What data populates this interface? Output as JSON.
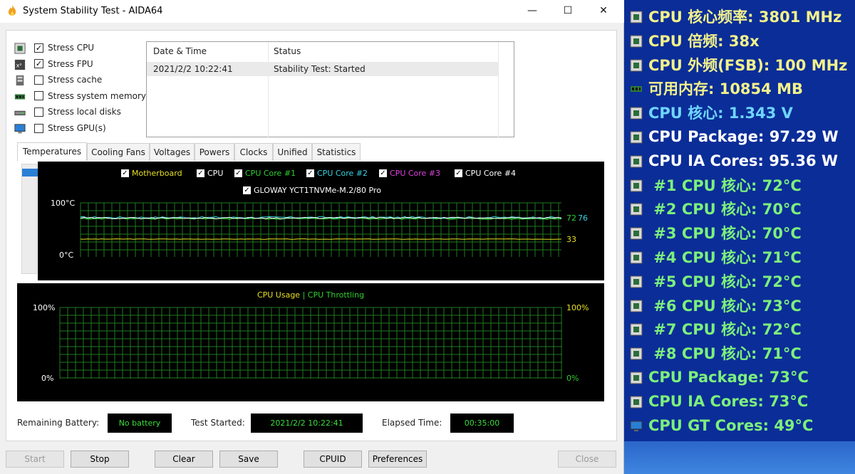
{
  "window": {
    "title": "System Stability Test - AIDA64",
    "minimize": "—",
    "maximize": "☐",
    "close": "✕"
  },
  "stress_options": [
    {
      "label": "Stress CPU",
      "checked": true,
      "icon": "cpu-icon"
    },
    {
      "label": "Stress FPU",
      "checked": true,
      "icon": "fpu-icon"
    },
    {
      "label": "Stress cache",
      "checked": false,
      "icon": "cache-icon"
    },
    {
      "label": "Stress system memory",
      "checked": false,
      "icon": "memory-icon"
    },
    {
      "label": "Stress local disks",
      "checked": false,
      "icon": "disk-icon"
    },
    {
      "label": "Stress GPU(s)",
      "checked": false,
      "icon": "gpu-icon"
    }
  ],
  "log": {
    "headers": [
      "Date & Time",
      "Status"
    ],
    "rows": [
      {
        "datetime": "2021/2/2 10:22:41",
        "status": "Stability Test: Started"
      }
    ]
  },
  "tabs": [
    "Temperatures",
    "Cooling Fans",
    "Voltages",
    "Powers",
    "Clocks",
    "Unified",
    "Statistics"
  ],
  "active_tab": "Temperatures",
  "temp_graph": {
    "legend": [
      {
        "label": "Motherboard",
        "color": "#e8e020"
      },
      {
        "label": "CPU",
        "color": "#ffffff"
      },
      {
        "label": "CPU Core #1",
        "color": "#2fd02f"
      },
      {
        "label": "CPU Core #2",
        "color": "#37d3e0"
      },
      {
        "label": "CPU Core #3",
        "color": "#e040e0"
      },
      {
        "label": "CPU Core #4",
        "color": "#ffffff"
      },
      {
        "label": "GLOWAY YCT1TNVMe-M.2/80 Pro",
        "color": "#ffffff"
      }
    ],
    "y_max_label": "100°C",
    "y_min_label": "0°C",
    "val_hot1": "72",
    "val_hot2": "76",
    "val_cool": "33"
  },
  "usage_graph": {
    "title_a": "CPU Usage",
    "separator": "|",
    "title_b": "CPU Throttling",
    "y_max_left": "100%",
    "y_min_left": "0%",
    "y_max_right": "100%",
    "y_min_right": "0%",
    "color_a": "#e8e020",
    "color_b": "#2fd02f"
  },
  "status_bar": {
    "battery_label": "Remaining Battery:",
    "battery_value": "No battery",
    "started_label": "Test Started:",
    "started_value": "2021/2/2 10:22:41",
    "elapsed_label": "Elapsed Time:",
    "elapsed_value": "00:35:00"
  },
  "buttons": {
    "start": "Start",
    "stop": "Stop",
    "clear": "Clear",
    "save": "Save",
    "cpuid": "CPUID",
    "preferences": "Preferences",
    "close": "Close"
  },
  "osd": [
    {
      "text": "CPU 核心频率: 3801 MHz",
      "color": "#f2f28a",
      "icon": "cpu-icon"
    },
    {
      "text": "CPU 倍频: 38x",
      "color": "#f2f28a",
      "icon": "cpu-icon"
    },
    {
      "text": "CPU 外频(FSB): 100 MHz",
      "color": "#f2f28a",
      "icon": "cpu-icon"
    },
    {
      "text": "可用内存: 10854 MB",
      "color": "#f2f28a",
      "icon": "memory-icon"
    },
    {
      "text": "CPU 核心: 1.343 V",
      "color": "#6fd6ff",
      "icon": "cpu-icon"
    },
    {
      "text": "CPU Package: 97.29 W",
      "color": "#ffffff",
      "icon": "cpu-icon"
    },
    {
      "text": "CPU IA Cores: 95.36 W",
      "color": "#ffffff",
      "icon": "cpu-icon"
    },
    {
      "text": " #1 CPU 核心: 72°C",
      "color": "#7cf07c",
      "icon": "cpu-icon"
    },
    {
      "text": " #2 CPU 核心: 70°C",
      "color": "#7cf07c",
      "icon": "cpu-icon"
    },
    {
      "text": " #3 CPU 核心: 70°C",
      "color": "#7cf07c",
      "icon": "cpu-icon"
    },
    {
      "text": " #4 CPU 核心: 71°C",
      "color": "#7cf07c",
      "icon": "cpu-icon"
    },
    {
      "text": " #5 CPU 核心: 72°C",
      "color": "#7cf07c",
      "icon": "cpu-icon"
    },
    {
      "text": " #6 CPU 核心: 73°C",
      "color": "#7cf07c",
      "icon": "cpu-icon"
    },
    {
      "text": " #7 CPU 核心: 72°C",
      "color": "#7cf07c",
      "icon": "cpu-icon"
    },
    {
      "text": " #8 CPU 核心: 71°C",
      "color": "#7cf07c",
      "icon": "cpu-icon"
    },
    {
      "text": "CPU Package: 73°C",
      "color": "#7cf07c",
      "icon": "cpu-icon"
    },
    {
      "text": "CPU IA Cores: 73°C",
      "color": "#7cf07c",
      "icon": "cpu-icon"
    },
    {
      "text": "CPU GT Cores: 49°C",
      "color": "#7cf07c",
      "icon": "gpu-icon"
    }
  ]
}
